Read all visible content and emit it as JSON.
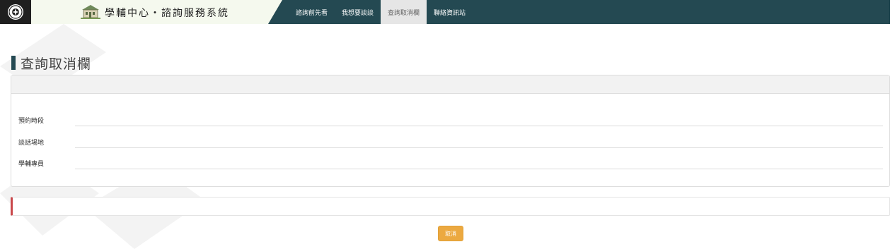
{
  "header": {
    "logo_icon": "university-seal-icon",
    "brand_icon": "building-icon",
    "brand_title": "學輔中心‧諮詢服務系統",
    "nav_items": [
      {
        "label": "諮詢前先看",
        "active": false
      },
      {
        "label": "我想要談談",
        "active": false
      },
      {
        "label": "查詢取消欄",
        "active": true
      },
      {
        "label": "聯絡資訊站",
        "active": false
      }
    ],
    "colors": {
      "navbar": "#244952",
      "active_tab": "#e6e6e6"
    }
  },
  "page": {
    "title": "查詢取消欄"
  },
  "query_panel": {
    "fields": [
      {
        "label": "預約時段",
        "value": ""
      },
      {
        "label": "談話場地",
        "value": ""
      },
      {
        "label": "學輔專員",
        "value": ""
      }
    ]
  },
  "alert": {
    "message": "",
    "accent_color": "#c9484b"
  },
  "actions": {
    "cancel_label": "取消",
    "cancel_color": "#eca940"
  }
}
